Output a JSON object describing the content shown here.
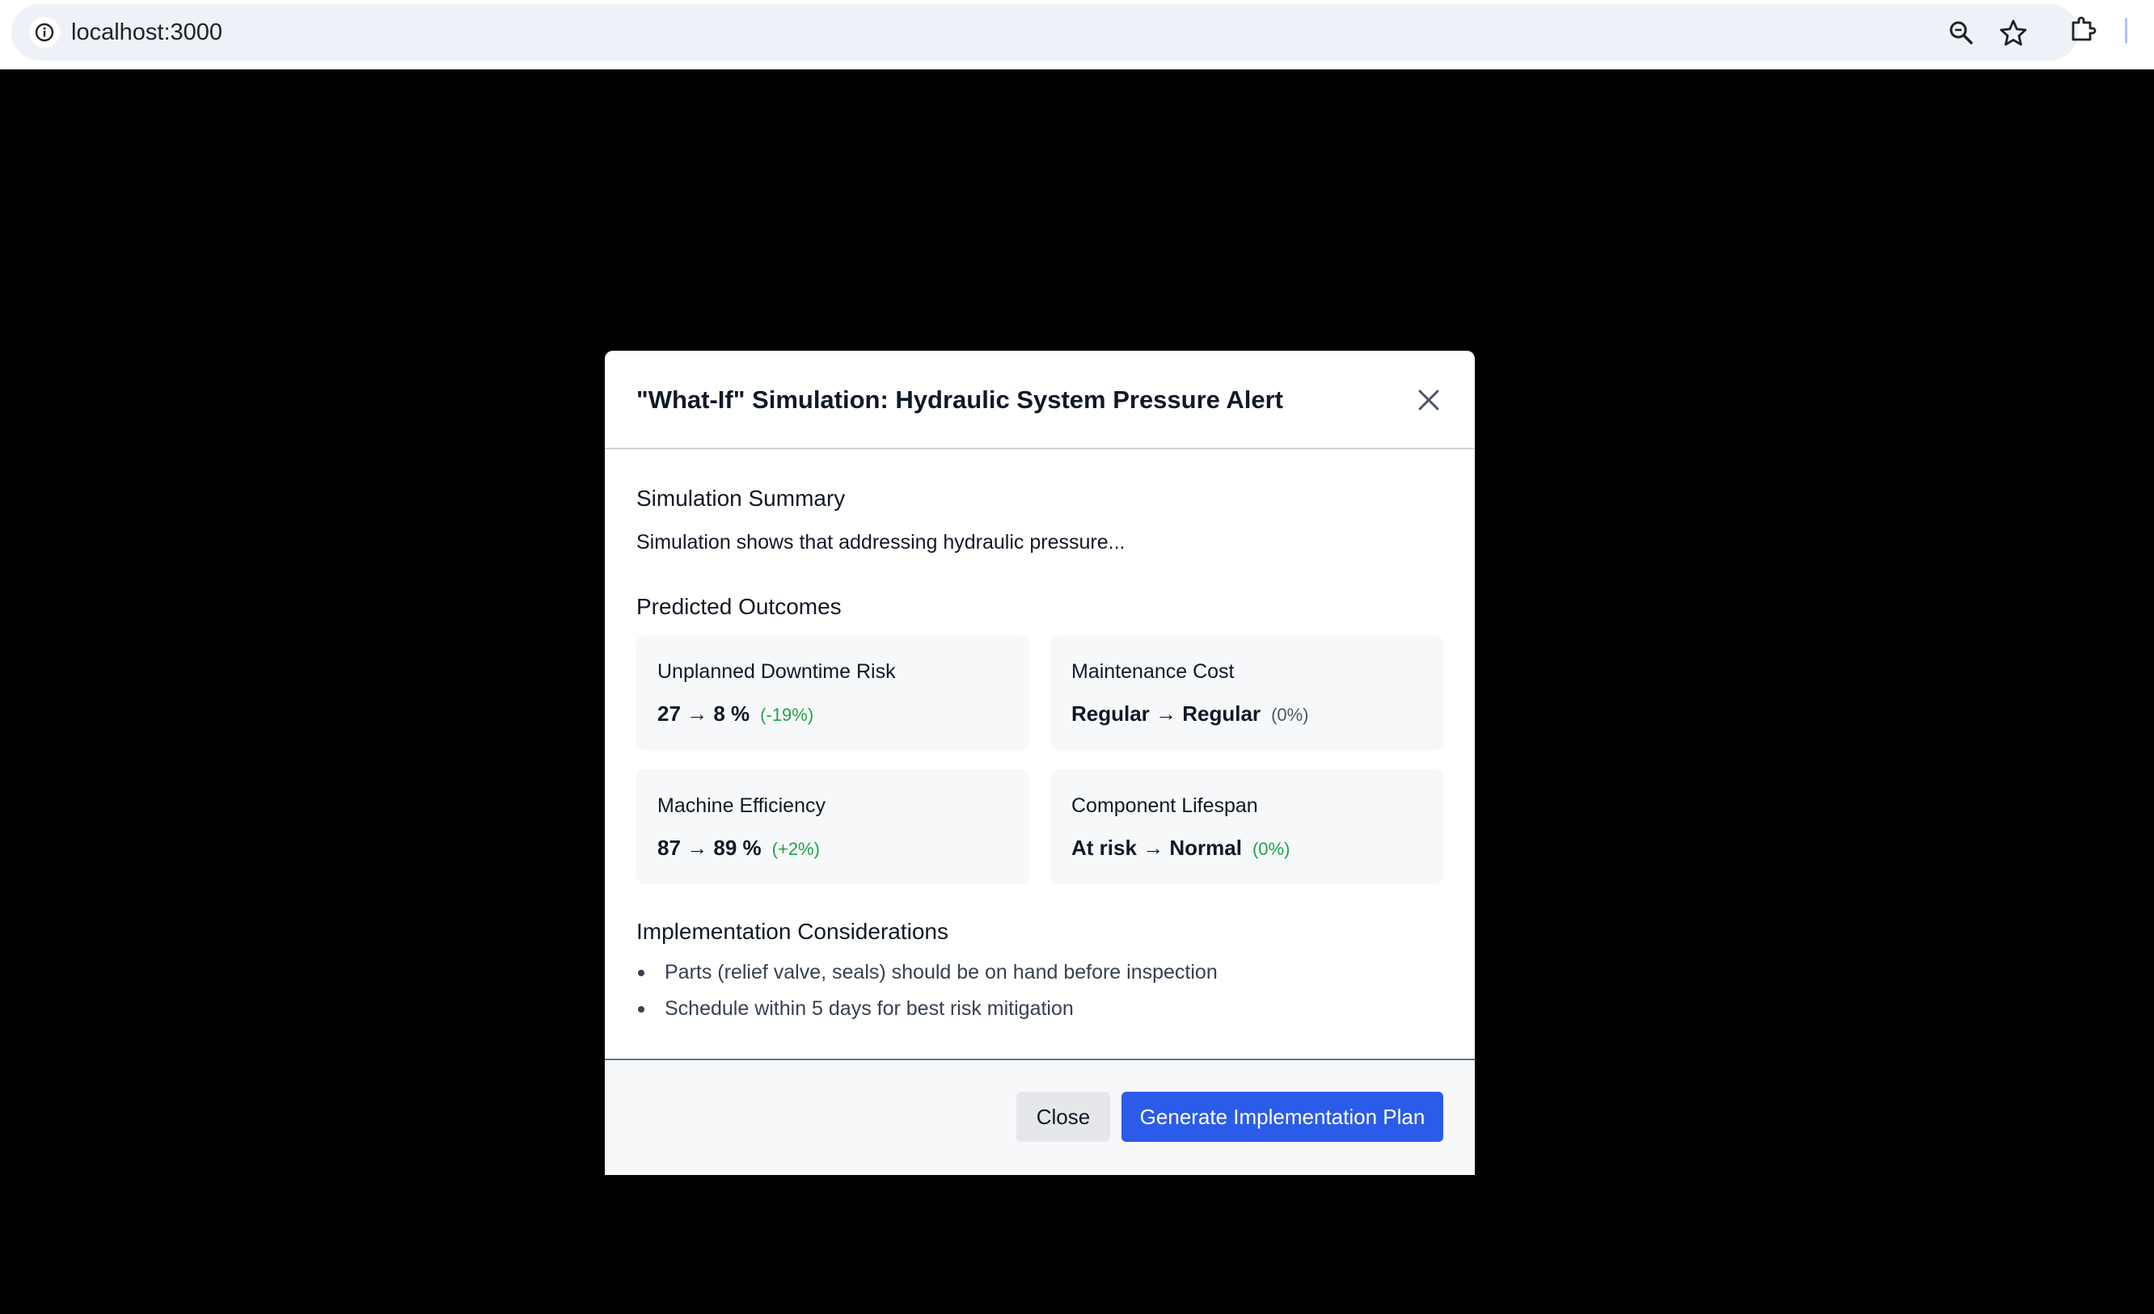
{
  "browser": {
    "url": "localhost:3000",
    "icons": [
      "info-icon",
      "zoom-icon",
      "bookmark-star-icon",
      "extensions-icon"
    ]
  },
  "modal": {
    "title": "\"What-If\" Simulation: Hydraulic System Pressure Alert",
    "close_icon": "close-icon",
    "summary": {
      "heading": "Simulation Summary",
      "text": "Simulation shows that addressing hydraulic pressure..."
    },
    "outcomes": {
      "heading": "Predicted Outcomes",
      "cards": [
        {
          "label": "Unplanned Downtime Risk",
          "value": "27 → 8 %",
          "change": "(-19%)",
          "change_color": "#22a347"
        },
        {
          "label": "Maintenance Cost",
          "value": "Regular → Regular",
          "change": "(0%)",
          "change_color": "#4b5563"
        },
        {
          "label": "Machine Efficiency",
          "value": "87 → 89 %",
          "change": "(+2%)",
          "change_color": "#22a347"
        },
        {
          "label": "Component Lifespan",
          "value": "At risk → Normal",
          "change": "(0%)",
          "change_color": "#22a347"
        }
      ]
    },
    "considerations": {
      "heading": "Implementation Considerations",
      "items": [
        "Parts (relief valve, seals) should be on hand before inspection",
        "Schedule within 5 days for best risk mitigation"
      ]
    },
    "footer": {
      "close_label": "Close",
      "generate_label": "Generate Implementation Plan",
      "primary_color": "#2b5ce9"
    }
  }
}
